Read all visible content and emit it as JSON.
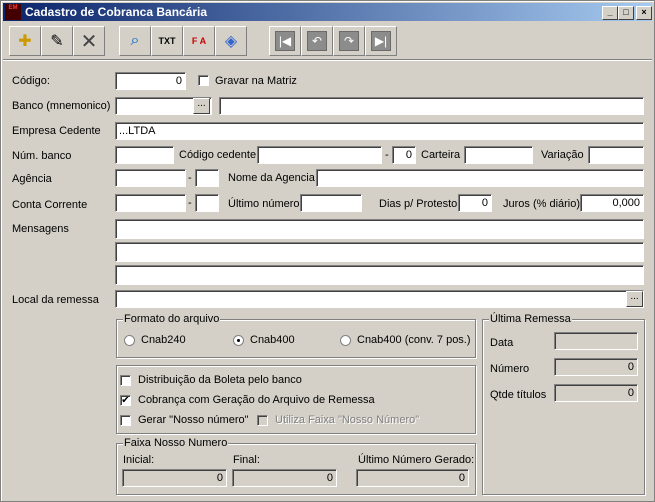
{
  "window": {
    "title": "Cadastro de Cobranca Bancária",
    "app_icon": "EM",
    "min": "_",
    "max": "□",
    "close": "×"
  },
  "toolbar": [
    "new-icon",
    "edit-icon",
    "delete-icon",
    "search-icon",
    "txt-icon",
    "fa-icon",
    "label-icon"
  ],
  "toolbar_text": {
    "txt": "TXT",
    "fa": "F A"
  },
  "nav": {
    "first": "|◀",
    "prev": "↶",
    "next": "↷",
    "last": "▶|"
  },
  "form": {
    "codigo_label": "Código:",
    "codigo_value": "0",
    "gravar_label": "Gravar na Matriz",
    "banco_label": "Banco (mnemonico)",
    "banco_value": "",
    "banco_desc": "",
    "ellipsis": "...",
    "empresa_label": "Empresa Cedente",
    "empresa_value": "...LTDA",
    "numbanco_label": "Núm. banco",
    "codcedente_label": "Código cedente",
    "dash": "-",
    "codcedente_dv": "0",
    "carteira_label": "Carteira",
    "variacao_label": "Variação",
    "agencia_label": "Agência",
    "nomeagencia_label": "Nome da Agencia",
    "conta_label": "Conta Corrente",
    "ultimo_label": "Último número",
    "dias_label": "Dias p/ Protesto",
    "dias_value": "0",
    "juros_label": "Juros (% diário):",
    "juros_value": "0,000",
    "mensagens_label": "Mensagens",
    "local_label": "Local da remessa"
  },
  "formato": {
    "title": "Formato do arquivo",
    "options": [
      "Cnab240",
      "Cnab400",
      "Cnab400 (conv. 7 pos.)"
    ],
    "selected": "Cnab400"
  },
  "opcoes": {
    "distrib_label": "Distribuição da Boleta pelo banco",
    "cobranca_label": "Cobrança com Geração do Arquivo de Remessa",
    "gerar_label": "Gerar \"Nosso número\"",
    "faixa_label": "Utiliza Faixa \"Nosso Número\"",
    "check": "✔"
  },
  "faixa": {
    "title": "Faixa Nosso Numero",
    "inicial_label": "Inicial:",
    "inicial_value": "0",
    "final_label": "Final:",
    "final_value": "0",
    "ultimo_label": "Último Número Gerado:",
    "ultimo_value": "0"
  },
  "ultima": {
    "title": "Última Remessa",
    "data_label": "Data",
    "data_value": "",
    "numero_label": "Número",
    "numero_value": "0",
    "qtde_label": "Qtde títulos",
    "qtde_value": "0"
  }
}
